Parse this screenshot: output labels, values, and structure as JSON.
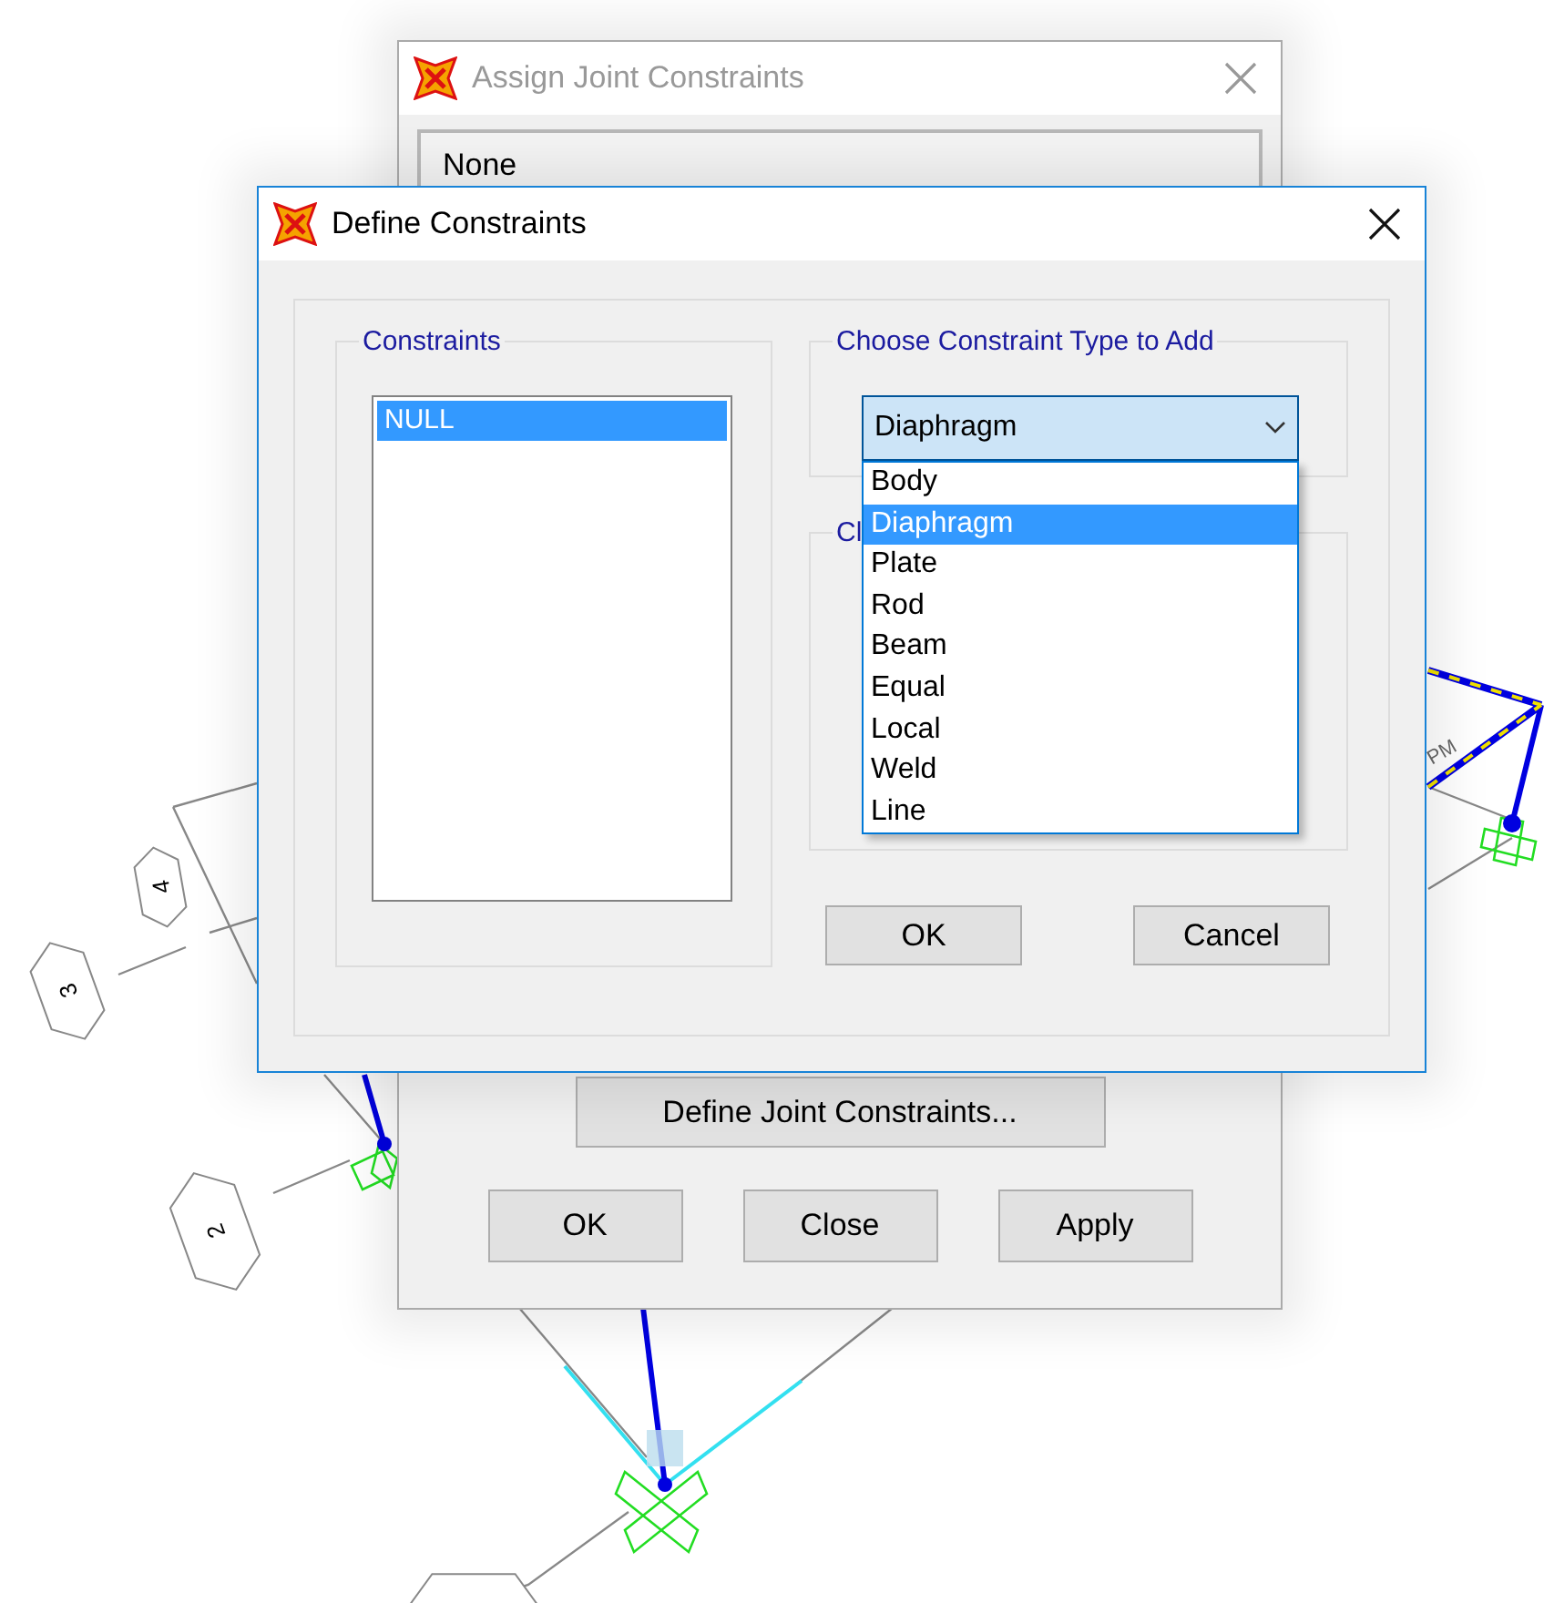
{
  "canvas": {
    "labels": [
      {
        "kind": "hex",
        "text": "4"
      },
      {
        "kind": "hex",
        "text": "3"
      },
      {
        "kind": "hex",
        "text": "2"
      },
      {
        "kind": "tag",
        "text": "PM"
      }
    ]
  },
  "assign_dialog": {
    "title": "Assign Joint Constraints",
    "active": false,
    "field_value": "None",
    "define_button": "Define Joint Constraints...",
    "buttons": [
      "OK",
      "Close",
      "Apply"
    ]
  },
  "define_dialog": {
    "title": "Define Constraints",
    "active": true,
    "constraints_group": {
      "label": "Constraints",
      "items": [
        {
          "label": "NULL",
          "selected": true
        }
      ]
    },
    "type_group": {
      "label": "Choose Constraint Type to Add",
      "value": "Diaphragm",
      "expanded": true,
      "options": [
        {
          "label": "Body",
          "selected": false
        },
        {
          "label": "Diaphragm",
          "selected": true
        },
        {
          "label": "Plate",
          "selected": false
        },
        {
          "label": "Rod",
          "selected": false
        },
        {
          "label": "Beam",
          "selected": false
        },
        {
          "label": "Equal",
          "selected": false
        },
        {
          "label": "Local",
          "selected": false
        },
        {
          "label": "Weld",
          "selected": false
        },
        {
          "label": "Line",
          "selected": false
        }
      ]
    },
    "second_group": {
      "label": "Cl"
    },
    "buttons": [
      "OK",
      "Cancel"
    ]
  }
}
